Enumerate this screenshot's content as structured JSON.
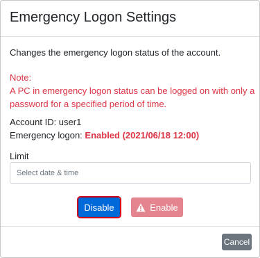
{
  "dialog": {
    "title": "Emergency Logon Settings",
    "description": "Changes the emergency logon status of the account.",
    "note": {
      "heading": "Note:",
      "line1": "A PC in emergency logon status can be logged on with only a",
      "line2": "password for a specified period of time."
    },
    "account_label": "Account ID: user1",
    "logon_label": "Emergency logon:",
    "logon_status": "Enabled (2021/06/18 12:00)",
    "limit_label": "Limit",
    "limit_input": {
      "value": "",
      "placeholder": "Select date & time"
    },
    "buttons": {
      "disable": "Disable",
      "enable": "Enable",
      "cancel": "Cancel"
    }
  },
  "colors": {
    "primary": "#0069d9",
    "danger": "#dc3545",
    "danger_disabled": "#e4848f",
    "secondary": "#6c757d",
    "highlight_border": "#d0021b"
  },
  "icons": {
    "enable_button_icon": "warning-triangle-icon"
  }
}
